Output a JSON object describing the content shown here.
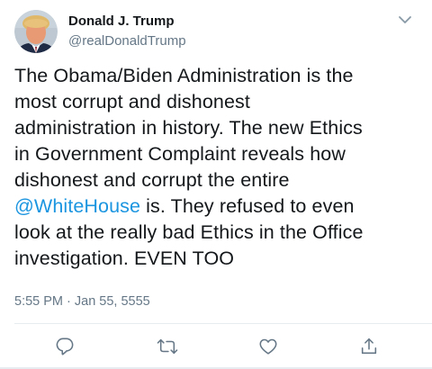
{
  "tweet": {
    "author": {
      "display_name": "Donald J. Trump",
      "handle": "@realDonaldTrump",
      "avatar_icon": "profile-photo"
    },
    "menu_icon": "chevron-down-icon",
    "text_lines": [
      "The Obama/Biden Administration is the",
      "most corrupt and dishonest",
      "administration in history. The new Ethics",
      "in Government Complaint reveals how",
      "dishonest and corrupt the entire"
    ],
    "mention": "@WhiteHouse",
    "text_after_mention": " is. They refused to even",
    "text_lines_end": [
      "look at the really bad Ethics in the Office",
      "investigation. EVEN TOO"
    ],
    "timestamp": "5:55 PM · Jan 55, 5555",
    "actions": [
      {
        "name": "reply",
        "icon": "reply-icon"
      },
      {
        "name": "retweet",
        "icon": "retweet-icon"
      },
      {
        "name": "like",
        "icon": "heart-icon"
      },
      {
        "name": "share",
        "icon": "share-icon"
      }
    ],
    "colors": {
      "text": "#14171a",
      "secondary": "#657786",
      "link": "#1b95e0",
      "divider": "#e6ecf0"
    }
  }
}
